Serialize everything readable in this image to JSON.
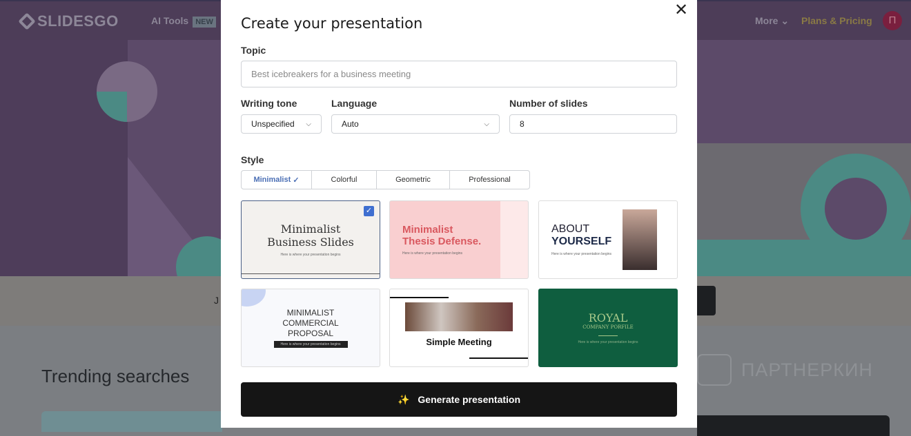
{
  "header": {
    "logo": "SLIDESGO",
    "ai_tools": "AI Tools",
    "new_badge": "NEW",
    "more": "More",
    "plans": "Plans & Pricing",
    "avatar_initial": "П"
  },
  "background": {
    "trending": "Trending searches",
    "partial_text": "J",
    "watermark": "ПАРТНЕРКИН"
  },
  "modal": {
    "title": "Create your presentation",
    "topic_label": "Topic",
    "topic_placeholder": "Best icebreakers for a business meeting",
    "tone_label": "Writing tone",
    "tone_value": "Unspecified",
    "language_label": "Language",
    "language_value": "Auto",
    "slides_label": "Number of slides",
    "slides_value": "8",
    "style_label": "Style",
    "styles": [
      "Minimalist",
      "Colorful",
      "Geometric",
      "Professional"
    ],
    "selected_style": "Minimalist",
    "templates": [
      {
        "title1": "Minimalist",
        "title2": "Business Slides",
        "sub": "Here is where your presentation begins",
        "selected": true
      },
      {
        "title1": "Minimalist",
        "title2": "Thesis Defense.",
        "sub": "Here is where your presentation begins"
      },
      {
        "title1": "ABOUT",
        "title2": "YOURSELF",
        "sub": "Here is where your presentation begins"
      },
      {
        "title1": "MINIMALIST",
        "title2": "COMMERCIAL",
        "title3": "PROPOSAL",
        "sub": "Here is where your presentation begins"
      },
      {
        "title1": "Simple Meeting"
      },
      {
        "title1": "ROYAL",
        "title2": "COMPANY PORFILE",
        "sub": "Here is where your presentation begins"
      }
    ],
    "generate": "Generate presentation"
  }
}
